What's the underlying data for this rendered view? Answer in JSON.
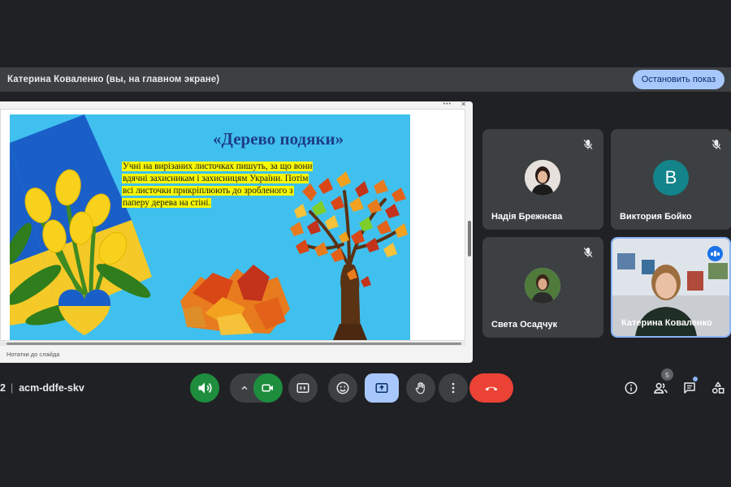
{
  "banner": {
    "presenter_text": "Катерина Коваленко (вы, на главном экране)",
    "stop_button": "Остановить показ"
  },
  "shared_screen": {
    "slide": {
      "title": "«Дерево подяки»",
      "body": "Учні на вирізаних листочках пишуть, за що вони вдячні захисникам і захисницям України. Потім всі листочки прикріплюють до зробленого з паперу дерева на стіні."
    },
    "notes_label": "Нотатки до слайда"
  },
  "participants": [
    {
      "name": "Надія Брежнєва",
      "muted": true,
      "avatar": "photo"
    },
    {
      "name": "Виктория Бойко",
      "muted": true,
      "avatar_letter": "В",
      "avatar_color": "#12848a"
    },
    {
      "name": "Света Осадчук",
      "muted": true,
      "avatar": "photo"
    },
    {
      "name": "Катерина Коваленко",
      "muted": false,
      "speaking": true,
      "video": true
    }
  ],
  "meeting": {
    "time_fragment": "2",
    "code": "acm-ddfe-skv"
  },
  "controls": {
    "icons": [
      "volume-icon",
      "chevron-up-icon",
      "camera-icon",
      "captions-icon",
      "emoji-icon",
      "present-icon",
      "raise-hand-icon",
      "more-icon",
      "hang-up-icon"
    ]
  },
  "side_panel": {
    "people_count": "5",
    "icons": [
      "info-icon",
      "people-icon",
      "chat-icon",
      "activities-icon"
    ]
  },
  "colors": {
    "background": "#202124",
    "accent_blue": "#a8c7fa",
    "green": "#1e8e3e",
    "red": "#ea4335",
    "slide_bg": "#40c0ee",
    "highlight": "#f7f705"
  }
}
